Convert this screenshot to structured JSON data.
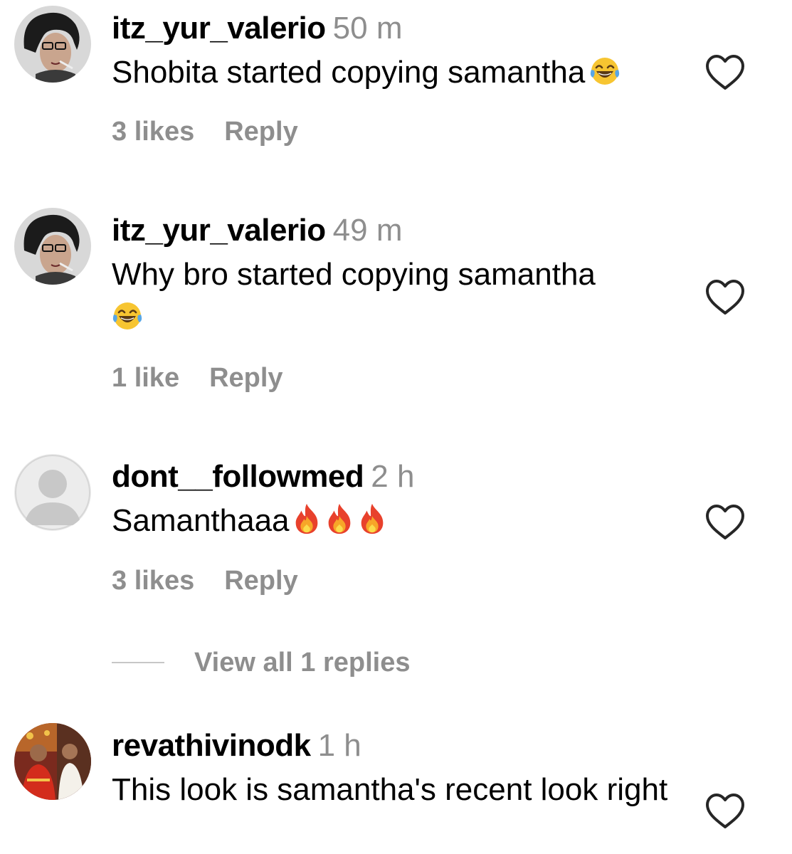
{
  "comments": [
    {
      "username": "itz_yur_valerio",
      "time": "50 m",
      "text": "Shobita started copying samantha",
      "emoji": "face-with-tears-of-joy",
      "likes": "3 likes",
      "reply_label": "Reply",
      "avatar": "comic-portrait"
    },
    {
      "username": "itz_yur_valerio",
      "time": "49 m",
      "text": "Why bro started copying samantha",
      "emoji": "face-with-tears-of-joy",
      "likes": "1 like",
      "reply_label": "Reply",
      "avatar": "comic-portrait"
    },
    {
      "username": "dont__followmed",
      "time": "2 h",
      "text": "Samanthaaa",
      "emoji": "fire x3",
      "likes": "3 likes",
      "reply_label": "Reply",
      "avatar": "default-profile"
    },
    {
      "username": "revathivinodk",
      "time": "1 h",
      "text": "This look is samantha's recent look right",
      "avatar": "couple-photo"
    }
  ],
  "view_replies_label": "View all 1 replies",
  "colors": {
    "text": "#000000",
    "muted": "#8e8e8e",
    "divider": "#c7c7c7",
    "background": "#ffffff"
  },
  "icons": {
    "like": "heart-outline-icon",
    "emoji_laugh": "face-with-tears-of-joy",
    "emoji_fire": "fire"
  }
}
